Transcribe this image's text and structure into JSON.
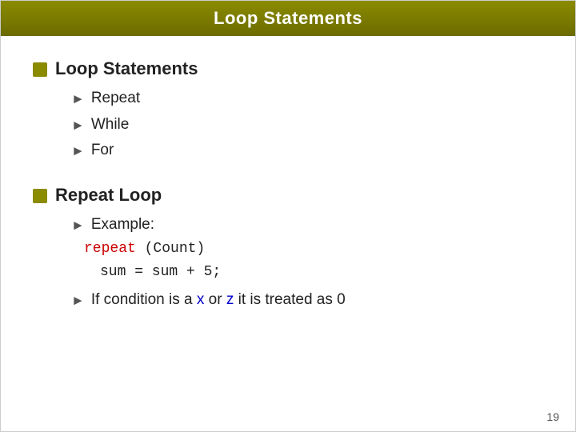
{
  "header": {
    "title": "Loop Statements"
  },
  "sections": [
    {
      "id": "section1",
      "heading": "Loop Statements",
      "subitems": [
        {
          "label": "Repeat"
        },
        {
          "label": "While"
        },
        {
          "label": "For"
        }
      ]
    },
    {
      "id": "section2",
      "heading": "Repeat Loop",
      "subitems": [
        {
          "label": "Example:",
          "code": [
            {
              "text": "repeat",
              "keyword": true,
              "suffix": " (Count)"
            },
            {
              "text": "sum = sum + 5;",
              "keyword": false,
              "indent": true
            }
          ]
        },
        {
          "label_prefix": "If condition is a ",
          "var1": "x",
          "label_mid": " or ",
          "var2": "z",
          "label_suffix": " it is treated as 0"
        }
      ]
    }
  ],
  "page_number": "19",
  "colors": {
    "accent": "#8b8b00",
    "keyword_red": "#cc0000",
    "var_blue": "#0000cc"
  }
}
